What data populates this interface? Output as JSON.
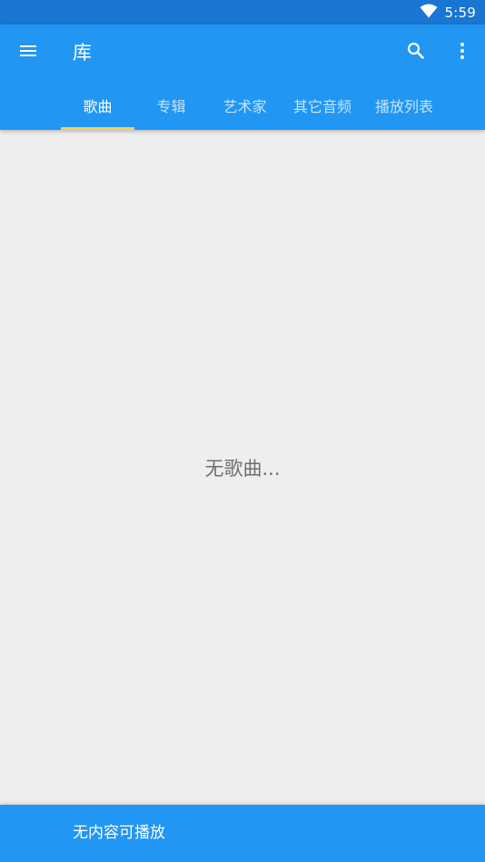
{
  "status_bar": {
    "time": "5:59",
    "wifi_icon": "wifi-icon"
  },
  "toolbar": {
    "title": "库",
    "menu_icon": "menu-icon",
    "search_icon": "search-icon",
    "more_icon": "more-vert-icon"
  },
  "tabs": [
    {
      "label": "歌曲",
      "active": true
    },
    {
      "label": "专辑"
    },
    {
      "label": "艺术家"
    },
    {
      "label": "其它音频"
    },
    {
      "label": "播放列表"
    }
  ],
  "main": {
    "empty_message": "无歌曲..."
  },
  "bottom_bar": {
    "text": "无内容可播放"
  },
  "colors": {
    "status_bar": "#1976d2",
    "primary": "#2196f3",
    "tab_indicator": "#f0d25a",
    "background": "#eeeeee"
  }
}
